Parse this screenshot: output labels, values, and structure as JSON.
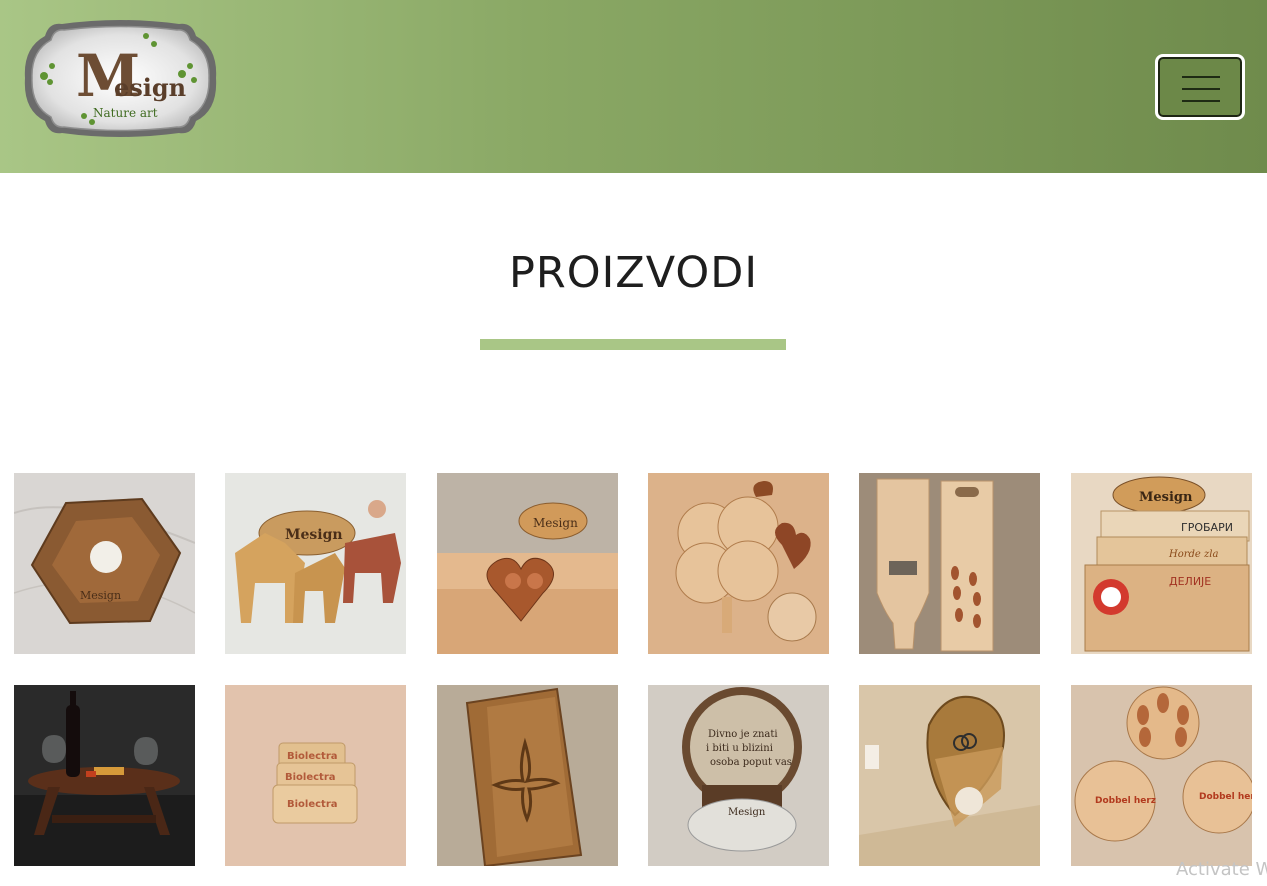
{
  "header": {
    "logo": {
      "brand": "Mesign",
      "tagline": "Nature art",
      "icon": "leaf-icon"
    },
    "menu_icon": "hamburger-menu-icon"
  },
  "page": {
    "title": "PROIZVODI"
  },
  "colors": {
    "header_gradient_start": "#a9c686",
    "header_gradient_end": "#6f8b4c",
    "accent_underline": "#a9c686",
    "title_text": "#1e1e1e"
  },
  "products": [
    {
      "name": "product-ashtray",
      "engraving": "Mesign"
    },
    {
      "name": "product-horse-puzzle",
      "engraving": "Mesign"
    },
    {
      "name": "product-heart-tray",
      "engraving": "Mesign"
    },
    {
      "name": "product-clover-board",
      "engraving": ""
    },
    {
      "name": "product-cutting-boards",
      "engraving": ""
    },
    {
      "name": "product-engraved-boards",
      "engraving": "Mesign",
      "lines": [
        "ГРОБАРИ",
        "Horde zla",
        "ДЕЛИЈЕ"
      ]
    },
    {
      "name": "product-wine-table",
      "engraving": ""
    },
    {
      "name": "product-usb-blocks",
      "lines": [
        "Biolectra",
        "Biolectra",
        "Biolectra"
      ]
    },
    {
      "name": "product-cross-box",
      "engraving": ""
    },
    {
      "name": "product-coaster-set",
      "lines": [
        "Divno je znati",
        "i biti u blizini",
        "osoba poput vas"
      ],
      "engraving": "Mesign"
    },
    {
      "name": "product-heart-box",
      "engraving": ""
    },
    {
      "name": "product-round-boxes",
      "lines": [
        "Dobbel herz",
        "Dobbel herz"
      ]
    }
  ],
  "system": {
    "watermark": "Activate W"
  }
}
